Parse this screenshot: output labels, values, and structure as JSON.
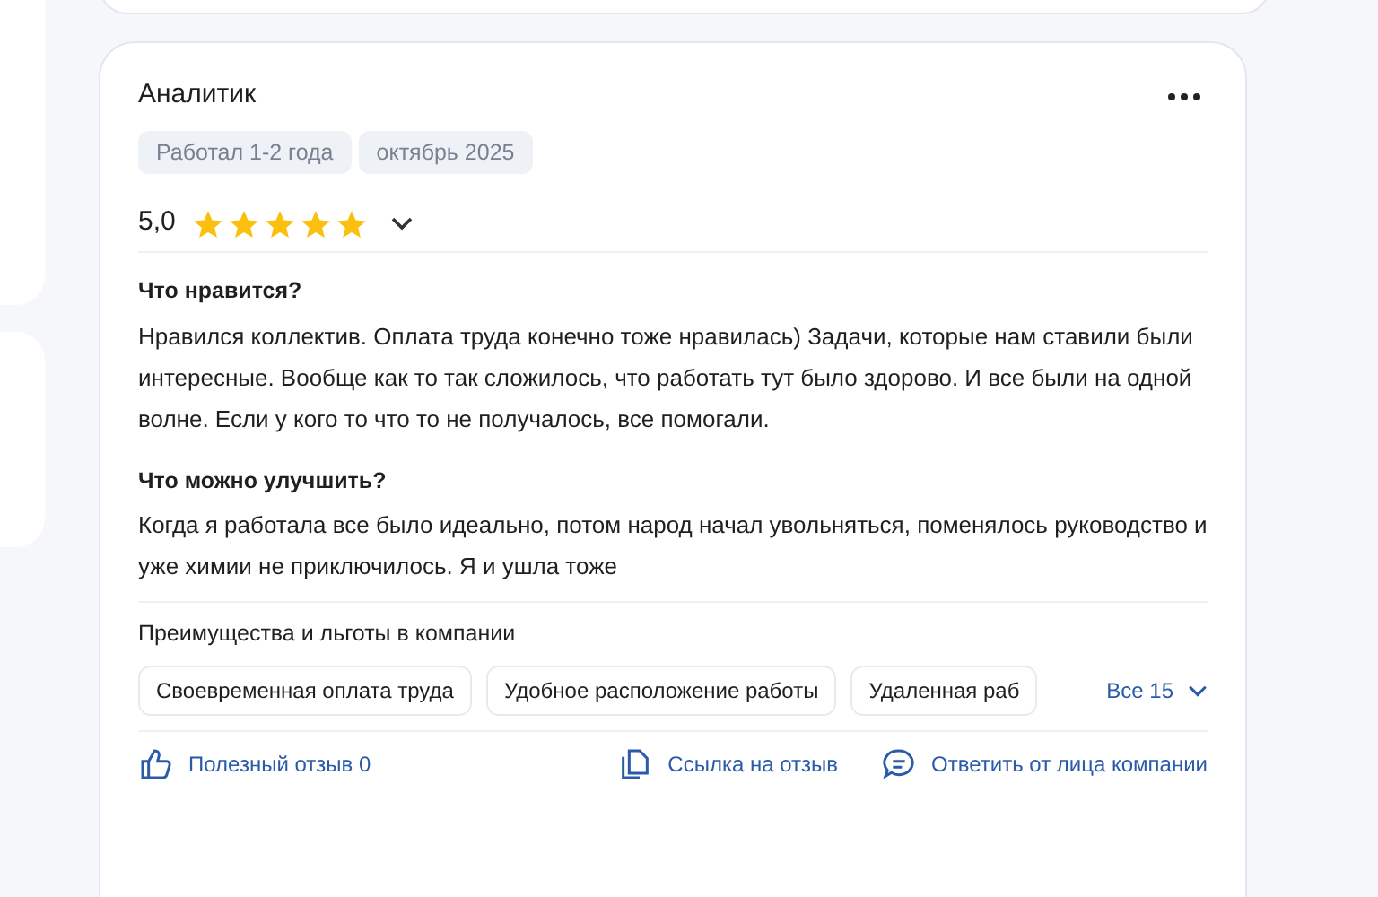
{
  "review": {
    "title": "Аналитик",
    "tags": [
      "Работал 1-2 года",
      "октябрь 2025"
    ],
    "rating": "5,0",
    "stars": 5,
    "sections": [
      {
        "heading": "Что нравится?",
        "text": "Нравился коллектив. Оплата труда конечно тоже нравилась) Задачи, которые нам ставили были интересные. Вообще как то так сложилось, что работать тут было здорово. И все были на одной волне. Если у кого то что то не получалось, все помогали."
      },
      {
        "heading": "Что можно улучшить?",
        "text": "Когда я работала все было идеально, потом народ начал увольняться, поменялось руководство и уже химии не приключилось. Я и ушла тоже"
      }
    ],
    "benefits": {
      "heading": "Преимущества и льготы в компании",
      "items": [
        "Своевременная оплата труда",
        "Удобное расположение работы",
        "Удаленная раб"
      ],
      "more": "Все 15"
    },
    "actions": [
      {
        "kind": "like",
        "label": "Полезный отзыв 0"
      },
      {
        "kind": "link",
        "label": "Ссылка на отзыв"
      },
      {
        "kind": "reply",
        "label": "Ответить от лица компании"
      }
    ]
  }
}
